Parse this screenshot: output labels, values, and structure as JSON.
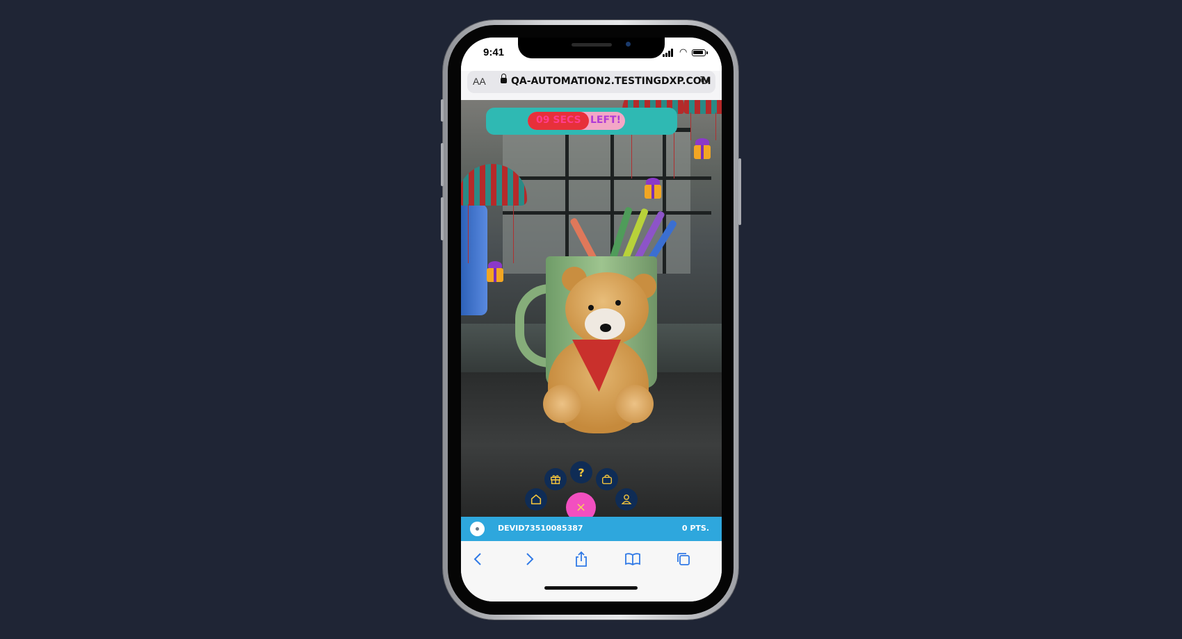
{
  "status_bar": {
    "time": "9:41"
  },
  "browser": {
    "aa_label": "AA",
    "url": "QA-AUTOMATION2.TESTINGDXP.COM"
  },
  "game": {
    "timer_secs": "09 SECS",
    "timer_left": "LEFT!",
    "fab_help_label": "?",
    "fab_close_label": "×"
  },
  "user_bar": {
    "username": "DEVID73510085387",
    "points": "0 PTS."
  },
  "colors": {
    "timer_banner": "#2fb9b3",
    "timer_secs_bg": "#e7303a",
    "fab_bg": "#0f2c55",
    "fab_icon": "#f2c33c",
    "fab_close": "#f24fc0",
    "user_bar": "#2ea7dd",
    "safari_accent": "#2f79e6"
  },
  "icons": {
    "fab": [
      "home-icon",
      "gift-icon",
      "help-icon",
      "bag-icon",
      "profile-icon"
    ],
    "toolbar": [
      "back-icon",
      "forward-icon",
      "share-icon",
      "bookmarks-icon",
      "tabs-icon"
    ]
  }
}
